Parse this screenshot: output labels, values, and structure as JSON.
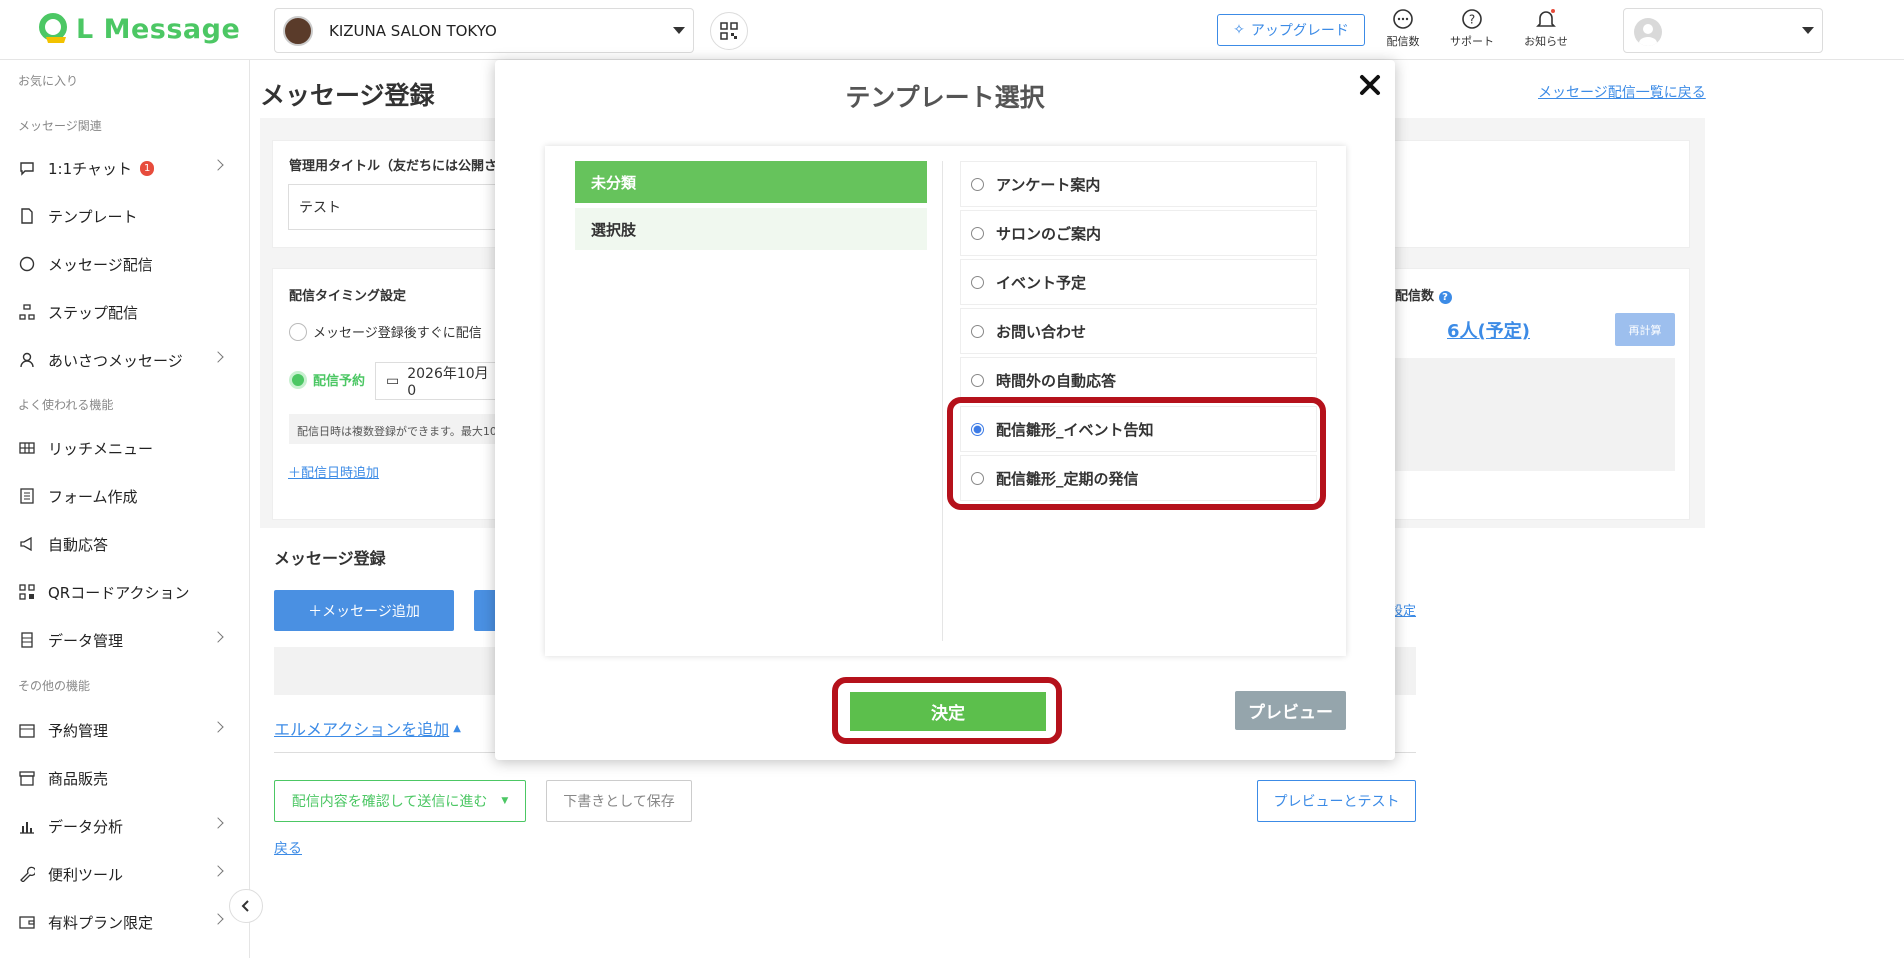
{
  "header": {
    "logo_text": "L Message",
    "account_name": "KIZUNA SALON TOKYO",
    "upgrade_label": "アップグレード",
    "icons": [
      {
        "name": "delivery-count-icon",
        "label": "配信数"
      },
      {
        "name": "support-icon",
        "label": "サポート"
      },
      {
        "name": "notification-icon",
        "label": "お知らせ"
      }
    ]
  },
  "sidebar": {
    "sections": {
      "favorites": "お気に入り",
      "message": "メッセージ関連",
      "frequent": "よく使われる機能",
      "other": "その他の機能"
    },
    "items": [
      {
        "label": "1:1チャット",
        "badge": "1"
      },
      {
        "label": "テンプレート"
      },
      {
        "label": "メッセージ配信"
      },
      {
        "label": "ステップ配信"
      },
      {
        "label": "あいさつメッセージ"
      },
      {
        "label": "リッチメニュー"
      },
      {
        "label": "フォーム作成"
      },
      {
        "label": "自動応答"
      },
      {
        "label": "QRコードアクション"
      },
      {
        "label": "データ管理"
      },
      {
        "label": "予約管理"
      },
      {
        "label": "商品販売"
      },
      {
        "label": "データ分析"
      },
      {
        "label": "便利ツール"
      },
      {
        "label": "有料プラン限定"
      }
    ]
  },
  "page": {
    "title": "メッセージ登録",
    "back_to_list": "メッセージ配信一覧に戻る",
    "admin_title_label": "管理用タイトル（友だちには公開さ",
    "admin_title_value": "テスト",
    "timing_label": "配信タイミング設定",
    "timing_immediate": "メッセージ登録後すぐに配信",
    "timing_scheduled": "配信予約",
    "scheduled_date": "2026年10月0",
    "schedule_note": "配信日時は複数登録ができます。最大10",
    "add_datetime": "＋配信日時追加",
    "delivery_count_label": "配信数",
    "delivery_count_value": "6人(予定)",
    "recalc_label": "再計算",
    "message_section_title": "メッセージ登録",
    "add_message": "＋メッセージ追加",
    "settings_link_tail": "設定",
    "add_action": "エルメアクションを追加",
    "proceed_send": "配信内容を確認して送信に進む",
    "save_draft": "下書きとして保存",
    "preview_test": "プレビューとテスト",
    "back": "戻る"
  },
  "modal": {
    "title": "テンプレート選択",
    "categories": [
      {
        "label": "未分類",
        "active": true
      },
      {
        "label": "選択肢",
        "active": false
      }
    ],
    "templates": [
      {
        "label": "アンケート案内",
        "selected": false
      },
      {
        "label": "サロンのご案内",
        "selected": false
      },
      {
        "label": "イベント予定",
        "selected": false
      },
      {
        "label": "お問い合わせ",
        "selected": false
      },
      {
        "label": "時間外の自動応答",
        "selected": false
      },
      {
        "label": "配信雛形_イベント告知",
        "selected": true
      },
      {
        "label": "配信雛形_定期の発信",
        "selected": false
      }
    ],
    "confirm_label": "決定",
    "preview_label": "プレビュー"
  },
  "colors": {
    "brand_green": "#4cc764",
    "accent_blue": "#3c8be6",
    "highlight_red": "#b5111b",
    "confirm_green": "#5cbf4c",
    "preview_gray": "#95a5ac"
  }
}
